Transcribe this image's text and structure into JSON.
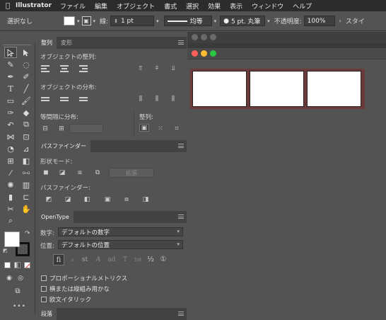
{
  "menubar": {
    "app_name": "Illustrator",
    "items": [
      "ファイル",
      "編集",
      "オブジェクト",
      "書式",
      "選択",
      "効果",
      "表示",
      "ウィンドウ",
      "ヘルプ"
    ]
  },
  "controlbar": {
    "selection_status": "選択なし",
    "stroke_label": "線:",
    "stroke_weight": "1 pt",
    "stroke_profile": "均等",
    "brush_definition": "5 pt. 丸筆",
    "opacity_label": "不透明度:",
    "opacity_value": "100%",
    "style_label": "スタイ"
  },
  "align_panel": {
    "tabs": [
      "整列",
      "変形"
    ],
    "align_objects_label": "オブジェクトの整列:",
    "distribute_objects_label": "オブジェクトの分布:",
    "distribute_spacing_label": "等間隔に分布:",
    "align_to_label": "整列:"
  },
  "pathfinder_panel": {
    "tab": "パスファインダー",
    "shape_modes_label": "形状モード:",
    "expand_button": "拡張",
    "pathfinders_label": "パスファインダー:"
  },
  "opentype_panel": {
    "tab": "OpenType",
    "figure_label": "数字:",
    "figure_value": "デフォルトの数字",
    "position_label": "位置:",
    "position_value": "デフォルトの位置",
    "glyph_buttons": [
      "fi",
      "ℴ",
      "st",
      "A",
      "ad",
      "T",
      "1st",
      "½",
      "①"
    ],
    "options": [
      "プロポーショナルメトリクス",
      "横または縦組み用かな",
      "欧文イタリック"
    ]
  },
  "paragraph_panel": {
    "tab": "段落"
  },
  "colors": {
    "ui_bg": "#535353",
    "canvas_bg": "#3a3a3a",
    "artboard_frame": "#6b3a3a",
    "close_red": "#fe5f57",
    "min_yellow": "#febc2e",
    "max_green": "#28c840"
  }
}
